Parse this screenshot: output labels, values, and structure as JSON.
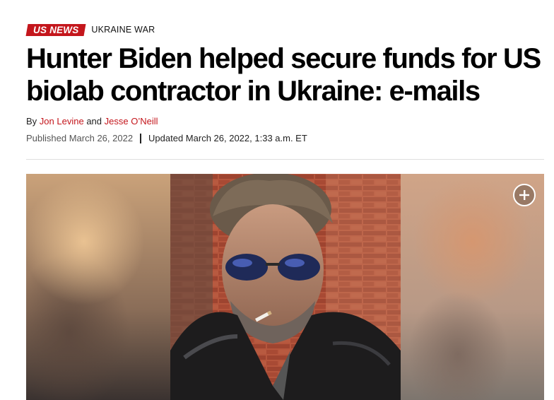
{
  "kicker": {
    "badge_label": "US NEWS",
    "section_label": "UKRAINE WAR"
  },
  "headline": "Hunter Biden helped secure funds for US biolab contractor in Ukraine: e-mails",
  "byline": {
    "prefix": "By",
    "author_1": "Jon Levine",
    "conjunction": "and",
    "author_2": "Jesse O’Neill"
  },
  "dates": {
    "published": "Published March 26, 2022",
    "updated": "Updated March 26, 2022, 1:33 a.m. ET"
  },
  "media": {
    "expand_icon": "plus-circle-icon"
  },
  "colors": {
    "brand_red": "#c4161c",
    "headline": "#000000",
    "meta_text": "#555555"
  }
}
